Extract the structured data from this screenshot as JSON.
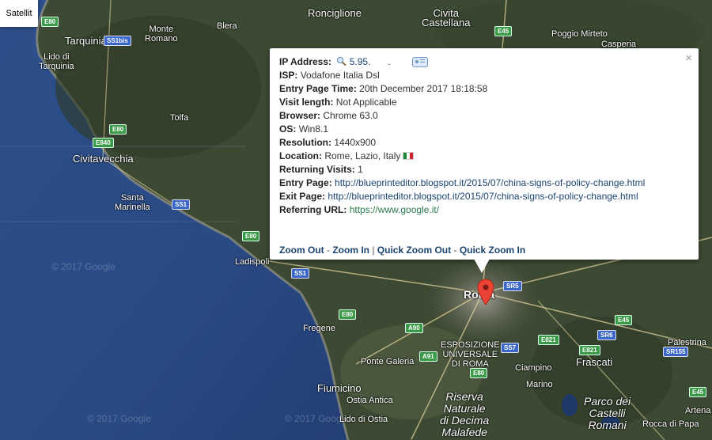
{
  "map": {
    "type_button": "Satellit",
    "watermarks": [
      "© 2017 Google",
      "© 2017 Google",
      "© 2017 Google"
    ],
    "places": [
      {
        "label": "Ronciglione",
        "cls": "place big"
      },
      {
        "label": "Civita\nCastellana",
        "cls": "place big"
      },
      {
        "label": "Poggio Mirteto",
        "cls": "place"
      },
      {
        "label": "Casperia",
        "cls": "place"
      },
      {
        "label": "Tarquinia",
        "cls": "place big"
      },
      {
        "label": "Monte\nRomano",
        "cls": "place"
      },
      {
        "label": "Blera",
        "cls": "place"
      },
      {
        "label": "Lido di\nTarquinia",
        "cls": "place"
      },
      {
        "label": "Tolfa",
        "cls": "place"
      },
      {
        "label": "Civitavecchia",
        "cls": "place big"
      },
      {
        "label": "Santa\nMarinella",
        "cls": "place"
      },
      {
        "label": "Ladispoli",
        "cls": "place"
      },
      {
        "label": "Fregene",
        "cls": "place"
      },
      {
        "label": "Roma",
        "cls": "place city"
      },
      {
        "label": "ESPOSIZIONE\nUNIVERSALE\nDI ROMA",
        "cls": "place"
      },
      {
        "label": "Ponte Galeria",
        "cls": "place"
      },
      {
        "label": "Ciampino",
        "cls": "place"
      },
      {
        "label": "Frascati",
        "cls": "place big"
      },
      {
        "label": "Marino",
        "cls": "place"
      },
      {
        "label": "Fiumicino",
        "cls": "place big"
      },
      {
        "label": "Ostia Antica",
        "cls": "place"
      },
      {
        "label": "Lido di Ostia",
        "cls": "place"
      },
      {
        "label": "Riserva\nNaturale\ndi Decima\nMalafede",
        "cls": "place italic"
      },
      {
        "label": "Parco dei\nCastelli\nRomani",
        "cls": "place italic"
      },
      {
        "label": "Palestrina",
        "cls": "place"
      },
      {
        "label": "Artena",
        "cls": "place"
      },
      {
        "label": "Rocca di Papa",
        "cls": "place"
      }
    ],
    "shields": [
      {
        "label": "E80",
        "color": "green"
      },
      {
        "label": "E45",
        "color": "green"
      },
      {
        "label": "SS1bis",
        "color": "blue"
      },
      {
        "label": "E80",
        "color": "green"
      },
      {
        "label": "E840",
        "color": "green"
      },
      {
        "label": "SS1",
        "color": "blue"
      },
      {
        "label": "E80",
        "color": "green"
      },
      {
        "label": "SS1",
        "color": "blue"
      },
      {
        "label": "E80",
        "color": "green"
      },
      {
        "label": "A90",
        "color": "green"
      },
      {
        "label": "A91",
        "color": "green"
      },
      {
        "label": "E80",
        "color": "green"
      },
      {
        "label": "SR5",
        "color": "blue"
      },
      {
        "label": "SS7",
        "color": "blue"
      },
      {
        "label": "E821",
        "color": "green"
      },
      {
        "label": "E821",
        "color": "green"
      },
      {
        "label": "SR6",
        "color": "blue"
      },
      {
        "label": "E45",
        "color": "green"
      },
      {
        "label": "SR155",
        "color": "blue"
      },
      {
        "label": "E45",
        "color": "green"
      }
    ]
  },
  "info": {
    "ip_label": "IP Address:",
    "ip_value": "5.95.",
    "ip_rest": ".",
    "isp_label": "ISP:",
    "isp_value": "Vodafone Italia Dsl",
    "entry_time_label": "Entry Page Time:",
    "entry_time_value": "20th December 2017 18:18:58",
    "visit_length_label": "Visit length:",
    "visit_length_value": "Not Applicable",
    "browser_label": "Browser:",
    "browser_value": "Chrome 63.0",
    "os_label": "OS:",
    "os_value": "Win8.1",
    "resolution_label": "Resolution:",
    "resolution_value": "1440x900",
    "location_label": "Location:",
    "location_value": "Rome, Lazio, Italy",
    "returning_label": "Returning Visits:",
    "returning_value": "1",
    "entry_page_label": "Entry Page:",
    "entry_page_value": "http://blueprinteditor.blogspot.it/2015/07/china-signs-of-policy-change.html",
    "exit_page_label": "Exit Page:",
    "exit_page_value": "http://blueprinteditor.blogspot.it/2015/07/china-signs-of-policy-change.html",
    "referring_label": "Referring URL:",
    "referring_value": "https://www.google.it/",
    "close": "×",
    "zoom_out": "Zoom Out",
    "dash1": " - ",
    "zoom_in": "Zoom In",
    "pipe": " | ",
    "quick_zoom_out": "Quick Zoom Out",
    "dash2": " - ",
    "quick_zoom_in": "Quick Zoom In"
  },
  "icons": {
    "search": "search-icon",
    "card": "id-card-icon",
    "flag": "italy-flag-icon",
    "pin": "map-pin-icon"
  }
}
